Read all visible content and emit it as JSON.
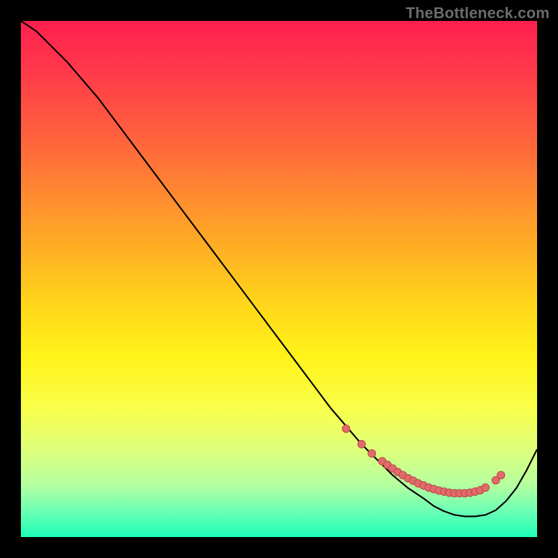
{
  "watermark": "TheBottleneck.com",
  "colors": {
    "background": "#000000",
    "curve": "#000000",
    "marker_fill": "#e16a6a",
    "marker_stroke": "#b84848"
  },
  "chart_data": {
    "type": "line",
    "title": "",
    "xlabel": "",
    "ylabel": "",
    "xlim": [
      0,
      100
    ],
    "ylim": [
      0,
      100
    ],
    "x": [
      0,
      3,
      6,
      9,
      12,
      15,
      18,
      21,
      24,
      27,
      30,
      33,
      36,
      39,
      42,
      45,
      48,
      51,
      54,
      57,
      60,
      63,
      66,
      69,
      72,
      75,
      78,
      80,
      82,
      84,
      86,
      88,
      90,
      92,
      94,
      96,
      98,
      100
    ],
    "values": [
      100,
      98,
      95,
      92,
      88.5,
      85,
      81,
      77,
      73,
      69,
      65,
      61,
      57,
      53,
      49,
      45,
      41,
      37,
      33,
      29,
      25,
      21.5,
      18,
      15,
      12,
      9.5,
      7.5,
      6,
      5,
      4.3,
      4,
      4,
      4.3,
      5.2,
      7,
      9.5,
      13,
      17
    ],
    "markers": {
      "x": [
        63,
        66,
        68,
        70,
        71,
        72,
        73,
        74,
        75,
        76,
        77,
        78,
        79,
        80,
        81,
        82,
        83,
        84,
        85,
        86,
        87,
        88,
        89,
        90,
        92,
        93
      ],
      "y": [
        21,
        18,
        16.2,
        14.7,
        14,
        13.3,
        12.6,
        12,
        11.4,
        10.9,
        10.4,
        10,
        9.6,
        9.3,
        9,
        8.8,
        8.6,
        8.5,
        8.5,
        8.5,
        8.6,
        8.8,
        9.1,
        9.6,
        11,
        12
      ]
    }
  }
}
